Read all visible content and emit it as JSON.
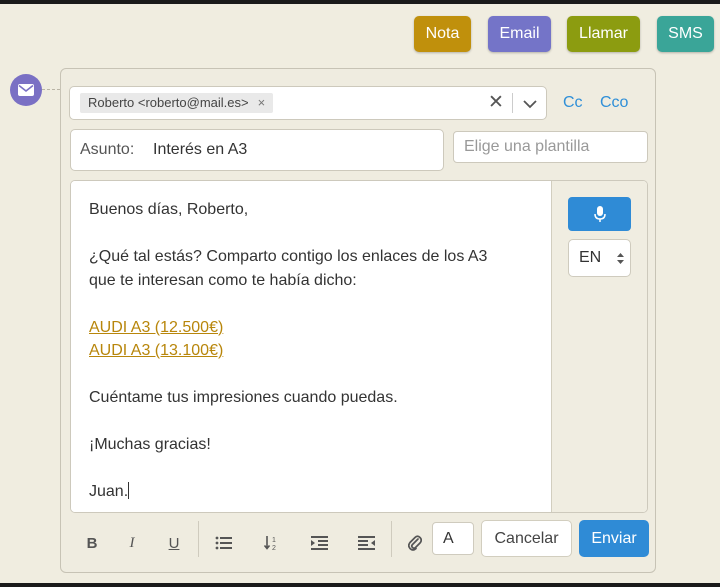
{
  "actions": {
    "nota": "Nota",
    "email": "Email",
    "llamar": "Llamar",
    "sms": "SMS"
  },
  "colors": {
    "nota": "#c0900c",
    "email": "#7474c8",
    "llamar": "#8c9c10",
    "sms": "#3aa598",
    "primary": "#2f8bd6",
    "link": "#b8860b",
    "badge": "#7a70c4"
  },
  "compose": {
    "badge_icon": "envelope-icon",
    "recipient": {
      "chip_label": "Roberto <roberto@mail.es>",
      "remove_symbol": "×",
      "clear_symbol": "✕",
      "dropdown_icon": "chevron-down-icon"
    },
    "cc_label": "Cc",
    "cco_label": "Cco",
    "subject_label": "Asunto:",
    "subject_value": "Interés en A3",
    "template_placeholder": "Elige una plantilla",
    "body": {
      "greeting": "Buenos días, Roberto,",
      "intro_line1": "¿Qué tal estás? Comparto contigo los enlaces de los A3",
      "intro_line2": "que te interesan como te había dicho:",
      "link1": "AUDI A3 (12.500€)",
      "link2": "AUDI A3 (13.100€)",
      "closing": "Cuéntame tus impresiones cuando puedas.",
      "thanks": "¡Muchas gracias!",
      "signature": "Juan."
    },
    "mic_icon": "microphone-icon",
    "language": "EN",
    "toolbar": {
      "bold": "B",
      "italic": "I",
      "underline": "U",
      "font_size": "A",
      "icons": [
        "bullet-list-icon",
        "sort-order-icon",
        "indent-icon",
        "outdent-icon",
        "paperclip-icon"
      ]
    },
    "cancel_label": "Cancelar",
    "send_label": "Enviar"
  }
}
